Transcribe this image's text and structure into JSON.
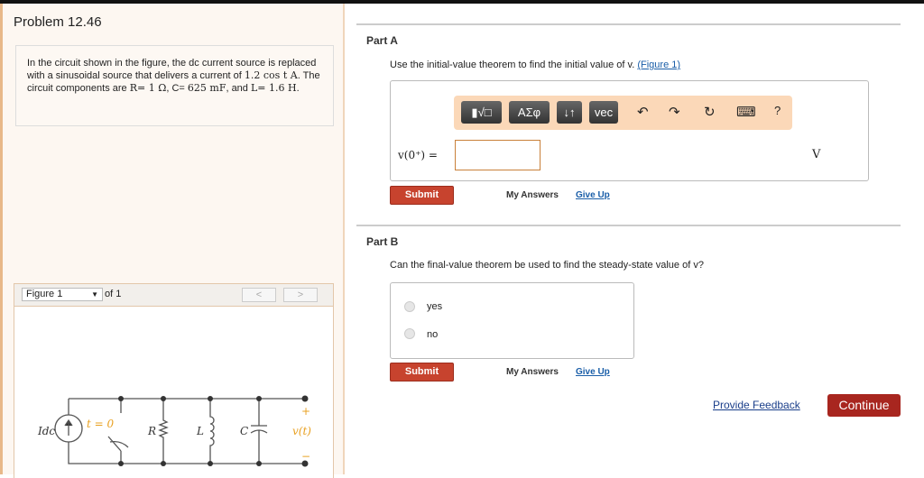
{
  "problem": {
    "title": "Problem 12.46",
    "desc_1": "In the circuit shown in the figure, the dc current source is replaced with a sinusoidal source that delivers a current of ",
    "current": "1.2 cos t A",
    "desc_2": ". The circuit components are ",
    "R": "R= 1 Ω",
    "C1": ", C=",
    "C2": "625 mF",
    "desc_3": ", and ",
    "L": "L= 1.6 H",
    "end": "."
  },
  "figure": {
    "select": "Figure 1",
    "of": "of 1",
    "prev": "<",
    "next": ">",
    "labels": {
      "source": "Idc",
      "switch": "t = 0",
      "R": "R",
      "L": "L",
      "C": "C",
      "v": "v(t)",
      "plus": "+",
      "minus": "−"
    }
  },
  "partA": {
    "label": "Part A",
    "question": "Use the initial-value theorem to find the initial value of v. ",
    "figure_link": "(Figure 1)",
    "toolbar": {
      "template": "▮√□",
      "greek": "AΣφ",
      "arrows": "↓↑",
      "vec": "vec",
      "undo": "↶",
      "redo": "↷",
      "reset": "↻",
      "keyboard": "⌨",
      "help": "?"
    },
    "answer_label": "v(0⁺) =",
    "answer_value": "",
    "unit": "V",
    "submit": "Submit",
    "my_answers": "My Answers",
    "give_up": "Give Up"
  },
  "partB": {
    "label": "Part B",
    "question": "Can the final-value theorem be used to find the steady-state value of v?",
    "options": [
      "yes",
      "no"
    ],
    "submit": "Submit",
    "my_answers": "My Answers",
    "give_up": "Give Up"
  },
  "footer": {
    "feedback": "Provide Feedback",
    "continue": "Continue"
  },
  "colors": {
    "accent": "#c7432e",
    "continue": "#a8261f",
    "toolbar": "#fbd8b8",
    "figure_label": "#e8a020"
  }
}
